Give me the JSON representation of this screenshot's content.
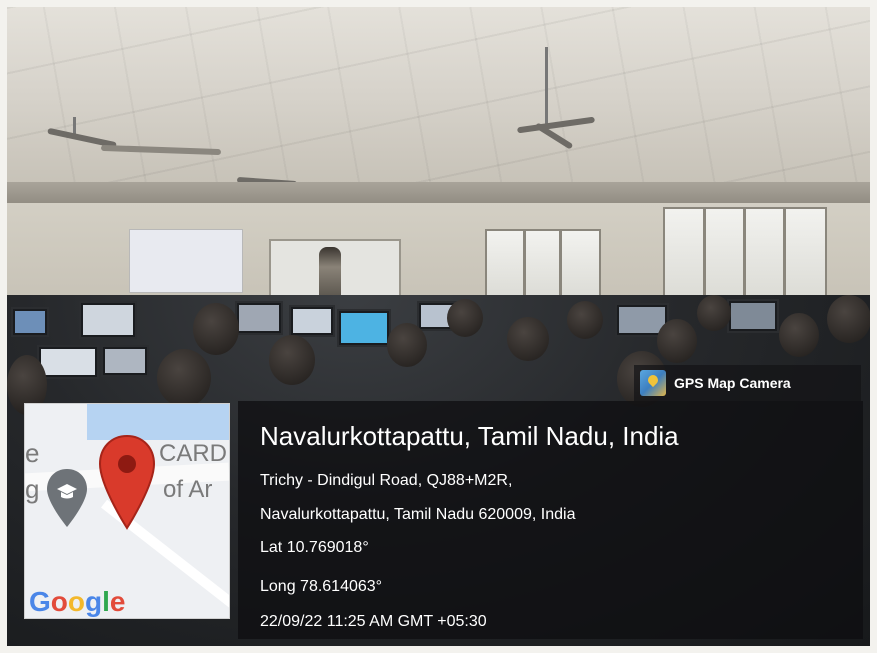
{
  "overlay": {
    "app_badge": "GPS Map Camera",
    "location_title": "Navalurkottapattu, Tamil Nadu, India",
    "address_line_1": "Trichy - Dindigul Road, QJ88+M2R,",
    "address_line_2": "Navalurkottapattu, Tamil Nadu 620009, India",
    "latitude": "Lat 10.769018°",
    "longitude": "Long 78.614063°",
    "datetime": "22/09/22 11:25 AM GMT +05:30"
  },
  "map": {
    "brand_letters": [
      "G",
      "o",
      "o",
      "g",
      "l",
      "e"
    ],
    "fragment_card": "CARD",
    "fragment_of": "of Ar",
    "fragment_e": "e",
    "fragment_g": "g",
    "pin_icon": "location-pin-icon",
    "school_icon": "school-pin-icon"
  },
  "colors": {
    "pin_red": "#d93a2b",
    "map_water_blue": "#b6d3f2"
  }
}
